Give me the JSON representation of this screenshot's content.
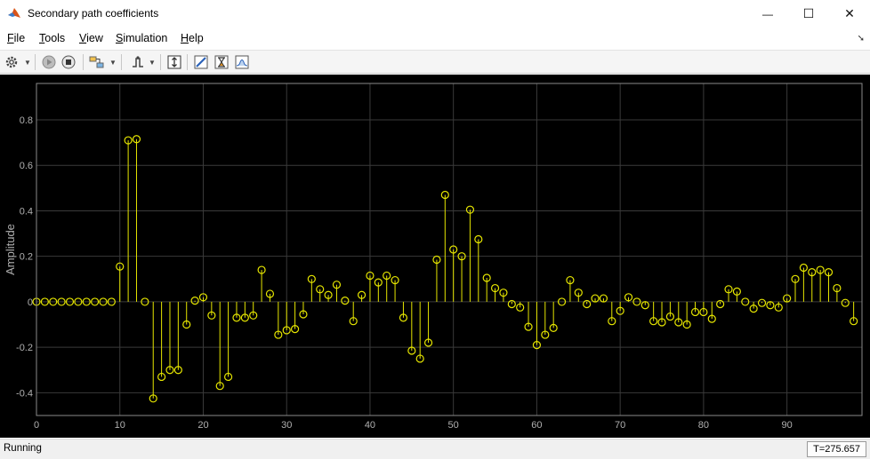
{
  "window": {
    "title": "Secondary path coefficients",
    "minimize_glyph": "—",
    "maximize_glyph": "☐",
    "close_glyph": "✕"
  },
  "menu": {
    "items": [
      {
        "label": "File",
        "accel": "F",
        "rest": "ile"
      },
      {
        "label": "Tools",
        "accel": "T",
        "rest": "ools"
      },
      {
        "label": "View",
        "accel": "V",
        "rest": "iew"
      },
      {
        "label": "Simulation",
        "accel": "S",
        "rest": "imulation"
      },
      {
        "label": "Help",
        "accel": "H",
        "rest": "elp"
      }
    ]
  },
  "toolbar": {
    "icons": [
      "gear-icon",
      "run-icon",
      "stop-icon",
      "signal-selector-icon",
      "trigger-icon",
      "autoscale-icon",
      "cursor-measure-icon",
      "peak-finder-icon",
      "statistics-icon"
    ]
  },
  "status": {
    "state": "Running",
    "time": "T=275.657"
  },
  "colors": {
    "plot_background": "#000000",
    "stem_color": "#e6e600",
    "grid_color": "#3a3a3a",
    "axis_text": "#b0b0b0"
  },
  "chart_data": {
    "type": "stem",
    "title": "",
    "xlabel": "",
    "ylabel": "Amplitude",
    "xlim": [
      0,
      99
    ],
    "ylim": [
      -0.5,
      0.96
    ],
    "grid": true,
    "legend": "none",
    "xticks": [
      0,
      10,
      20,
      30,
      40,
      50,
      60,
      70,
      80,
      90
    ],
    "yticks": [
      -0.4,
      -0.2,
      0,
      0.2,
      0.4,
      0.6,
      0.8
    ],
    "xtick_labels": [
      "0",
      "10",
      "20",
      "30",
      "40",
      "50",
      "60",
      "70",
      "80",
      "90"
    ],
    "ytick_labels": [
      "-0.4",
      "-0.2",
      "0",
      "0.2",
      "0.4",
      "0.6",
      "0.8"
    ],
    "x": [
      0,
      1,
      2,
      3,
      4,
      5,
      6,
      7,
      8,
      9,
      10,
      11,
      12,
      13,
      14,
      15,
      16,
      17,
      18,
      19,
      20,
      21,
      22,
      23,
      24,
      25,
      26,
      27,
      28,
      29,
      30,
      31,
      32,
      33,
      34,
      35,
      36,
      37,
      38,
      39,
      40,
      41,
      42,
      43,
      44,
      45,
      46,
      47,
      48,
      49,
      50,
      51,
      52,
      53,
      54,
      55,
      56,
      57,
      58,
      59,
      60,
      61,
      62,
      63,
      64,
      65,
      66,
      67,
      68,
      69,
      70,
      71,
      72,
      73,
      74,
      75,
      76,
      77,
      78,
      79,
      80,
      81,
      82,
      83,
      84,
      85,
      86,
      87,
      88,
      89,
      90,
      91,
      92,
      93,
      94,
      95,
      96,
      97,
      98
    ],
    "values": [
      0,
      0,
      0,
      0,
      0,
      0,
      0,
      0,
      0,
      0,
      0.155,
      0.71,
      0.715,
      0,
      -0.425,
      -0.33,
      -0.3,
      -0.3,
      -0.1,
      0.005,
      0.02,
      -0.06,
      -0.37,
      -0.33,
      -0.07,
      -0.07,
      -0.06,
      0.14,
      0.035,
      -0.145,
      -0.125,
      -0.12,
      -0.055,
      0.1,
      0.055,
      0.03,
      0.075,
      0.005,
      -0.085,
      0.03,
      0.115,
      0.085,
      0.115,
      0.095,
      -0.07,
      -0.215,
      -0.25,
      -0.18,
      0.185,
      0.47,
      0.23,
      0.2,
      0.405,
      0.275,
      0.105,
      0.06,
      0.04,
      -0.01,
      -0.025,
      -0.11,
      -0.19,
      -0.145,
      -0.115,
      0,
      0.095,
      0.04,
      -0.01,
      0.015,
      0.015,
      -0.085,
      -0.04,
      0.02,
      0,
      -0.015,
      -0.085,
      -0.09,
      -0.065,
      -0.09,
      -0.1,
      -0.045,
      -0.045,
      -0.075,
      -0.01,
      0.055,
      0.045,
      0,
      -0.03,
      -0.005,
      -0.015,
      -0.025,
      0.015,
      0.1,
      0.15,
      0.13,
      0.14,
      0.13,
      0.06,
      -0.005,
      -0.085,
      -0.115
    ]
  }
}
